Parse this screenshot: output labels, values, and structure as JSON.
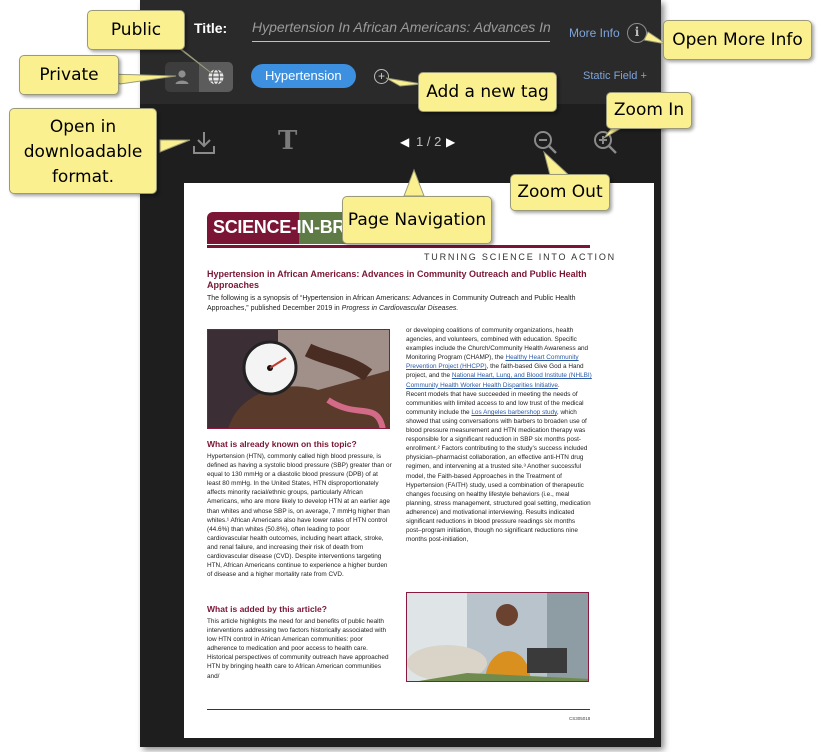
{
  "header": {
    "title_label": "Title:",
    "title_value": "Hypertension In African Americans: Advances In Community Outreach and Public Health Approaches",
    "more_info_label": "More Info",
    "info_icon": "info-icon",
    "tag_label": "Hypertension",
    "add_tag_glyph": "+",
    "static_field_label": "Static Field +"
  },
  "privacy": {
    "private_icon": "person-icon",
    "public_icon": "globe-icon",
    "selected": "public"
  },
  "toolbar": {
    "download_icon": "download-icon",
    "text_tool_glyph": "T",
    "page_prev_glyph": "◀",
    "page_indicator": "1 / 2",
    "page_next_glyph": "▶",
    "zoom_out_icon": "zoom-out-icon",
    "zoom_in_icon": "zoom-in-icon"
  },
  "document": {
    "banner": "SCIENCE-IN-BRIEF",
    "tagline": "TURNING SCIENCE INTO ACTION",
    "title": "Hypertension in African Americans: Advances in Community Outreach and Public Health Approaches",
    "synopsis": "The following is a synopsis of “Hypertension in African Americans: Advances in Community Outreach and Public Health Approaches,” published December 2019 in",
    "synopsis_journal": "Progress in Cardiovascular Diseases.",
    "heading_known": "What is already known on this topic?",
    "para_known": "Hypertension (HTN), commonly called high blood pressure, is defined as having a systolic blood pressure (SBP) greater than or equal to 130 mmHg or a diastolic blood pressure (DPB) of at least 80 mmHg. In the United States, HTN disproportionately affects minority racial/ethnic groups, particularly African Americans, who are more likely to develop HTN at an earlier age than whites and whose SBP is, on average, 7 mmHg higher than whites.¹ African Americans also have lower rates of HTN control (44.6%) than whites (50.8%), often leading to poor cardiovascular health outcomes, including heart attack, stroke, and renal failure, and increasing their risk of death from cardiovascular disease (CVD). Despite interventions targeting HTN, African Americans continue to experience a higher burden of disease and a higher mortality rate from CVD.",
    "heading_added": "What is added by this article?",
    "para_added": "This article highlights the need for and benefits of public health interventions addressing two factors historically associated with low HTN control in African American communities: poor adherence to medication and poor access to health care. Historical perspectives of community outreach have approached HTN by bringing health care to African American communities and/",
    "col2_a": "or developing coalitions of community organizations, health agencies, and volunteers, combined with education. Specific examples include the Church/Community Health Awareness and Monitoring Program (CHAMP), the",
    "col2_link1": "Healthy Heart Community Prevention Project (HHCPP)",
    "col2_b": ", the faith-based Give God a Hand project, and the",
    "col2_link2": "National Heart, Lung, and Blood Institute (NHLBI) Community Health Worker Health Disparities Initiative",
    "col2_c": ".",
    "col2_d": "Recent models that have succeeded in meeting the needs of communities with limited access to and low trust of the medical community include the",
    "col2_link3": "Los Angeles barbershop study",
    "col2_e": ", which showed that using conversations with barbers to broaden use of blood pressure measurement and HTN medication therapy was responsible for a significant reduction in SBP six months post-enrollment.² Factors contributing to the study’s success included physician–pharmacist collaboration, an effective anti-HTN drug regimen, and intervening at a trusted site.³ Another successful model, the Faith-based Approaches in the Treatment of Hypertension (FAITH) study, used a combination of therapeutic changes focusing on healthy lifestyle behaviors (i.e., meal planning, stress management, structured goal setting, medication adherence) and motivational interviewing. Results indicated significant reductions in blood pressure readings six months post–program initiation, though no significant reductions nine months post-initiation,",
    "footer_code": "CS305018"
  },
  "callouts": {
    "public": "Public",
    "private": "Private",
    "open_more_info": "Open More Info",
    "add_tag": "Add a new tag",
    "zoom_in": "Zoom In",
    "open_downloadable": "Open in downloadable format.",
    "zoom_out": "Zoom Out",
    "page_navigation": "Page Navigation"
  },
  "colors": {
    "accent_blue": "#3d8fe0",
    "brand_maroon": "#7a1535",
    "brand_green": "#5e7a45",
    "callout_yellow": "#fbf08f"
  }
}
